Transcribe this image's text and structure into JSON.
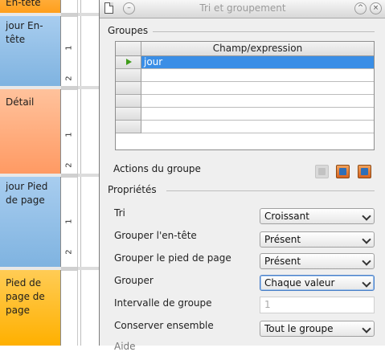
{
  "designer": {
    "sections": [
      {
        "label": "En-tête"
      },
      {
        "label": "jour En-tête"
      },
      {
        "label": "Détail"
      },
      {
        "label": "jour Pied de page"
      },
      {
        "label": "Pied de page de page"
      }
    ],
    "ruler_numbers": [
      "1",
      "2",
      "1",
      "2",
      "1",
      "2"
    ]
  },
  "dialog": {
    "title": "Tri et groupement",
    "groups_heading": "Groupes",
    "grid": {
      "column_header": "Champ/expression",
      "rows": [
        "jour",
        "",
        "",
        "",
        "",
        ""
      ],
      "selected_row": 0
    },
    "group_actions_label": "Actions du groupe",
    "properties_heading": "Propriétés",
    "properties": [
      {
        "label": "Tri",
        "value": "Croissant",
        "type": "select"
      },
      {
        "label": "Grouper l'en-tête",
        "value": "Présent",
        "type": "select"
      },
      {
        "label": "Grouper le pied de page",
        "value": "Présent",
        "type": "select"
      },
      {
        "label": "Grouper",
        "value": "Chaque valeur",
        "type": "select",
        "focused": true
      },
      {
        "label": "Intervalle de groupe",
        "value": "1",
        "type": "text",
        "disabled": true
      },
      {
        "label": "Conserver ensemble",
        "value": "Tout le groupe",
        "type": "select"
      }
    ],
    "cut_label": "Aide"
  },
  "colors": {
    "selection": "#3a8ee6",
    "row_marker": "#3f9c1a",
    "section_orange": "#ff9f1c",
    "section_blue": "#7fb3e0",
    "section_peach": "#ff9a63",
    "section_gold": "#ffb000"
  }
}
